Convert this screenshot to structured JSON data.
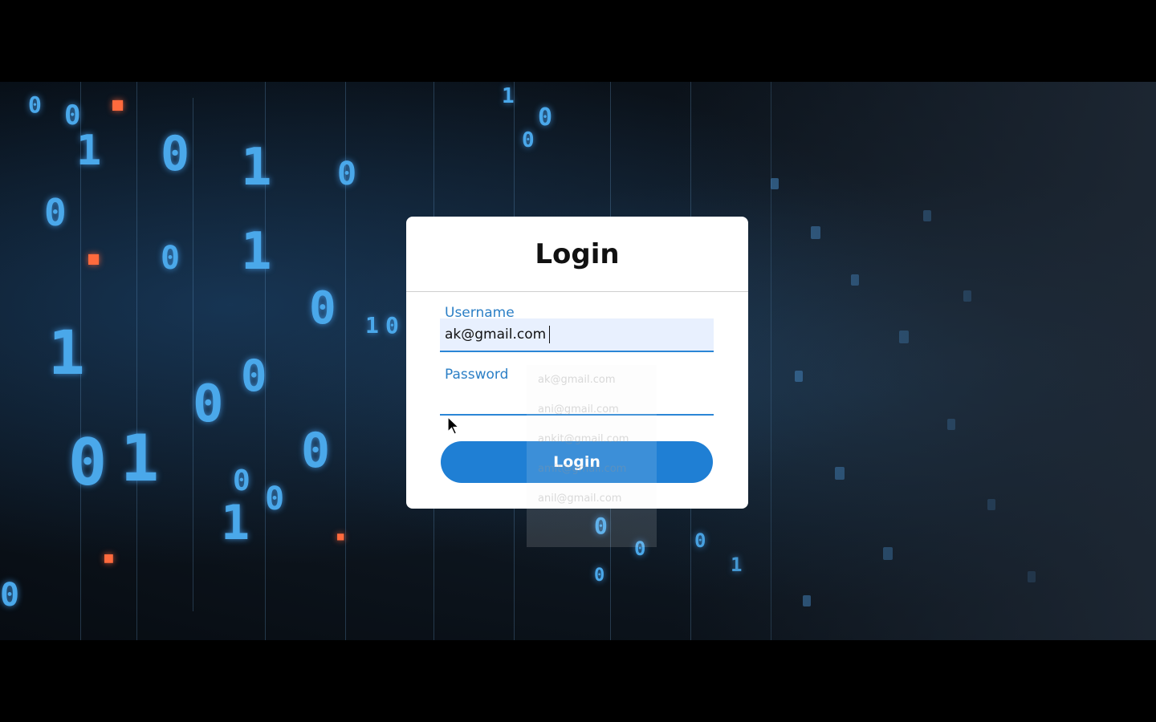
{
  "login_card": {
    "title": "Login",
    "username": {
      "label": "Username",
      "value": "ak@gmail.com"
    },
    "password": {
      "label": "Password",
      "value": ""
    },
    "submit_label": "Login"
  },
  "autofill_suggestions": [
    "ak@gmail.com",
    "ani@gmail.com",
    "ankit@gmail.com",
    "amit@gmail.com",
    "anil@gmail.com"
  ],
  "colors": {
    "accent": "#1f7fd4",
    "label": "#2b7fc6",
    "autofill_bg": "#e8f0fe"
  }
}
